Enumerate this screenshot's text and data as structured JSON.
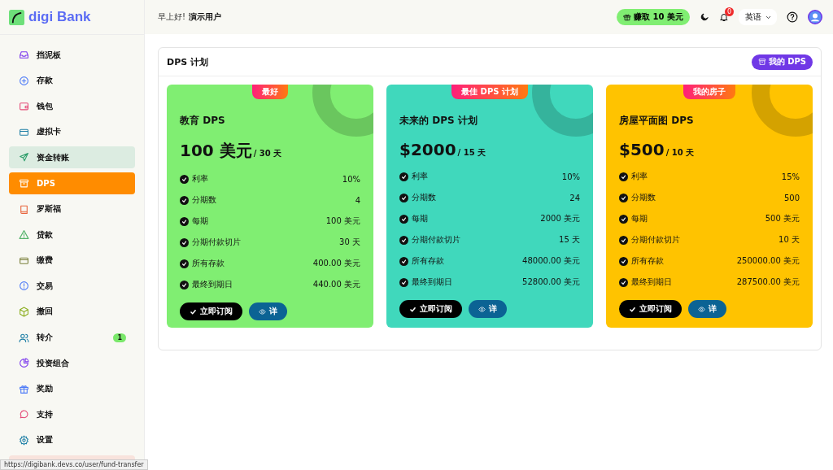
{
  "brand": {
    "name": "digi Bank"
  },
  "sidebar": {
    "items": [
      {
        "label": "挡泥板",
        "selected": false,
        "kind": "plain"
      },
      {
        "label": "存款",
        "selected": false,
        "kind": "plain"
      },
      {
        "label": "钱包",
        "selected": false,
        "kind": "plain"
      },
      {
        "label": "虚拟卡",
        "selected": false,
        "kind": "plain"
      },
      {
        "label": "资金转账",
        "selected": false,
        "kind": "hover"
      },
      {
        "label": "DPS",
        "selected": true,
        "kind": "plain"
      },
      {
        "label": "罗斯福",
        "selected": false,
        "kind": "plain"
      },
      {
        "label": "贷款",
        "selected": false,
        "kind": "plain"
      },
      {
        "label": "缴费",
        "selected": false,
        "kind": "plain"
      },
      {
        "label": "交易",
        "selected": false,
        "kind": "plain"
      },
      {
        "label": "撤回",
        "selected": false,
        "kind": "plain"
      },
      {
        "label": "转介",
        "selected": false,
        "kind": "plain",
        "badge": "1"
      },
      {
        "label": "投资组合",
        "selected": false,
        "kind": "plain"
      },
      {
        "label": "奖励",
        "selected": false,
        "kind": "plain"
      },
      {
        "label": "支持",
        "selected": false,
        "kind": "plain"
      },
      {
        "label": "设置",
        "selected": false,
        "kind": "plain"
      },
      {
        "kind": "danger"
      }
    ]
  },
  "header": {
    "greeting": "早上好!",
    "user": "演示用户",
    "earn_button": "赚取 10 美元",
    "notification_count": "0",
    "language": "英语"
  },
  "panel": {
    "title": "DPS 计划",
    "my_dps_button": "我的 DPS",
    "plans": [
      {
        "badge": "最好",
        "title": "教育 DPS",
        "amount": "100 美元",
        "period": "/ 30 天",
        "color": "#80ee72",
        "rows": [
          {
            "label": "利率",
            "value": "10%"
          },
          {
            "label": "分期数",
            "value": "4"
          },
          {
            "label": "每期",
            "value": "100 美元"
          },
          {
            "label": "分期付款切片",
            "value": "30 天"
          },
          {
            "label": "所有存款",
            "value": "400.00 美元"
          },
          {
            "label": "最终到期日",
            "value": "440.00 美元"
          }
        ],
        "subscribe": "立即订阅",
        "details": "详"
      },
      {
        "badge": "最佳 DPS 计划",
        "title": "未来的 DPS 计划",
        "amount": "$2000",
        "period": "/ 15 天",
        "color": "#40d8bc",
        "rows": [
          {
            "label": "利率",
            "value": "10%"
          },
          {
            "label": "分期数",
            "value": "24"
          },
          {
            "label": "每期",
            "value": "2000 美元"
          },
          {
            "label": "分期付款切片",
            "value": "15 天"
          },
          {
            "label": "所有存款",
            "value": "48000.00 美元"
          },
          {
            "label": "最终到期日",
            "value": "52800.00 美元"
          }
        ],
        "subscribe": "立即订阅",
        "details": "详"
      },
      {
        "badge": "我的房子",
        "title": "房屋平面图 DPS",
        "amount": "$500",
        "period": "/ 10 天",
        "color": "#ffc300",
        "rows": [
          {
            "label": "利率",
            "value": "15%"
          },
          {
            "label": "分期数",
            "value": "500"
          },
          {
            "label": "每期",
            "value": "500 美元"
          },
          {
            "label": "分期付款切片",
            "value": "10 天"
          },
          {
            "label": "所有存款",
            "value": "250000.00 美元"
          },
          {
            "label": "最终到期日",
            "value": "287500.00 美元"
          }
        ],
        "subscribe": "立即订阅",
        "details": "详"
      }
    ]
  },
  "status_bar": {
    "url": "https://digibank.devs.co/user/fund-transfer"
  }
}
